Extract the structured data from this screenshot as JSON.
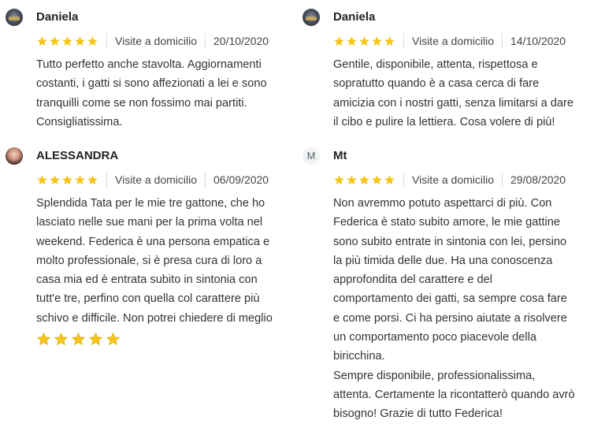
{
  "colors": {
    "star": "#f5c518",
    "text": "#333333"
  },
  "reviews": [
    {
      "author": "Daniela",
      "avatar": "photo",
      "rating": 5,
      "service": "Visite a domicilio",
      "date": "20/10/2020",
      "text": "Tutto perfetto anche stavolta. Aggiornamenti\ncostanti, i gatti si sono affezionati a lei e sono\ntranquilli come se non fossimo mai partiti.\nConsigliatissima."
    },
    {
      "author": "Daniela",
      "avatar": "photo",
      "rating": 5,
      "service": "Visite a domicilio",
      "date": "14/10/2020",
      "text": "Gentile, disponibile, attenta, rispettosa e\nsopratutto quando è a casa cerca di fare\namicizia con i nostri gatti, senza limitarsi a dare\nil cibo e pulire la lettiera. Cosa volere di più!"
    },
    {
      "author": "ALESSANDRA",
      "avatar": "photo",
      "rating": 5,
      "service": "Visite a domicilio",
      "date": "06/09/2020",
      "text": "Splendida Tata per le mie tre gattone, che ho\nlasciato nelle sue mani per la prima volta nel\nweekend. Federica è una persona empatica e\nmolto professionale, si è presa cura di loro a\ncasa mia ed è entrata subito in sintonia con\ntutt'e tre, perfino con quella col carattere più\nschivo e difficile. Non potrei chiedere di meglio"
    },
    {
      "author": "Mt",
      "avatar_letter": "M",
      "rating": 5,
      "service": "Visite a domicilio",
      "date": "29/08/2020",
      "text": "Non avremmo potuto aspettarci di più. Con\nFederica è stato subito amore, le mie gattine\nsono subito entrate in sintonia con lei, persino\nla più timida delle due. Ha una conoscenza\napprofondita del carattere e del\ncomportamento dei gatti, sa sempre cosa fare\ne come porsi. Ci ha persino aiutate a risolvere\nun comportamento poco piacevole della\nbiricchina.\nSempre disponibile, professionalissima,\nattenta. Certamente la ricontatterò quando avrò\nbisogno! Grazie di tutto Federica!"
    }
  ]
}
